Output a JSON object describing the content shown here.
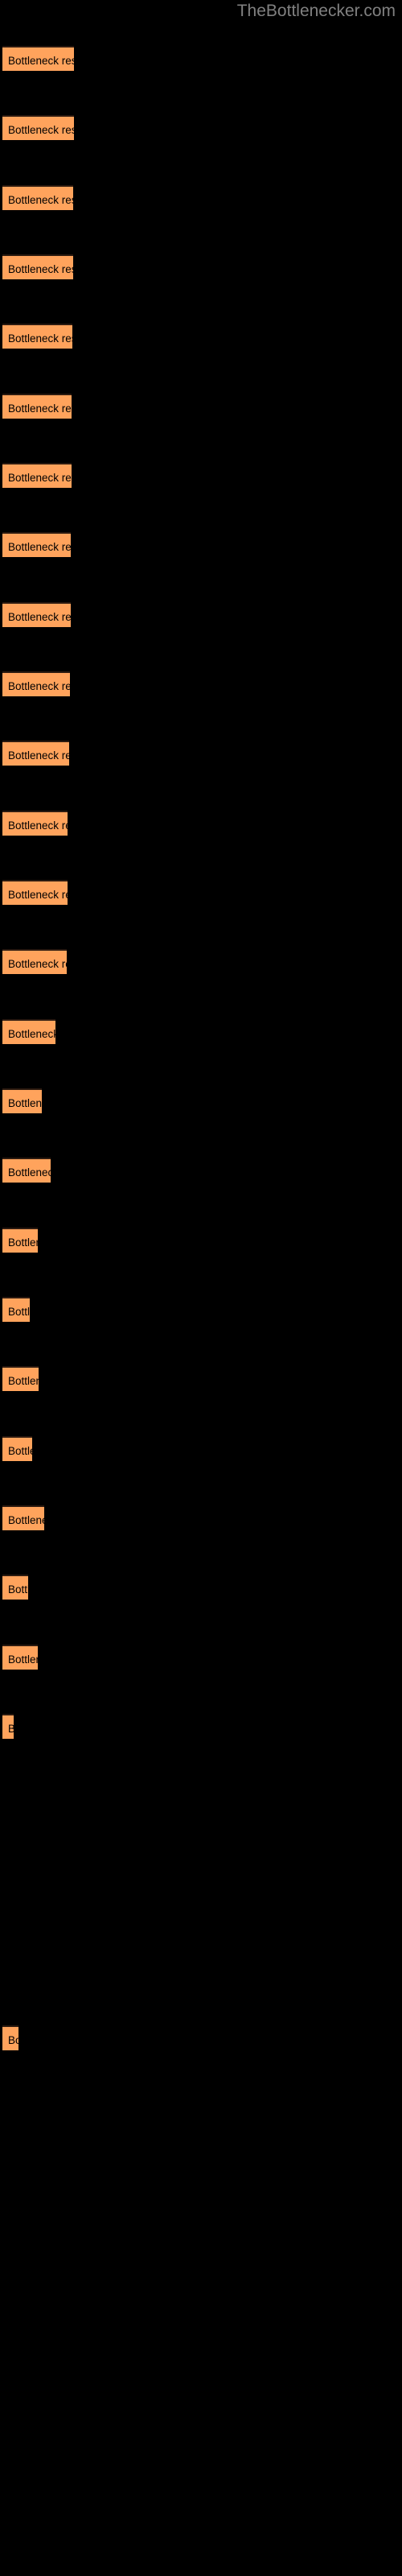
{
  "site": {
    "watermark": "TheBottlenecker.com"
  },
  "chart_data": {
    "type": "bar",
    "orientation": "horizontal",
    "title": "",
    "subtitle": "",
    "xlabel": "",
    "ylabel": "",
    "grid": false,
    "legend": null,
    "background_color": "#000000",
    "bar_color": "#ffa35c",
    "bar_border_color": "#2b1a10",
    "label_color": "#000000",
    "watermark_color": "#808080",
    "bar_label_text": "Bottleneck result",
    "xlim": [
      0,
      500
    ],
    "categories": [
      "Bottleneck result",
      "Bottleneck result",
      "Bottleneck result",
      "Bottleneck result",
      "Bottleneck result",
      "Bottleneck result",
      "Bottleneck result",
      "Bottleneck result",
      "Bottleneck result",
      "Bottleneck result",
      "Bottleneck result",
      "Bottleneck result",
      "Bottleneck result",
      "Bottleneck result",
      "Bottleneck result",
      "Bottleneck result",
      "Bottleneck result",
      "Bottleneck result",
      "Bottleneck result",
      "Bottleneck result",
      "Bottleneck result",
      "Bottleneck result",
      "Bottleneck result",
      "Bottleneck result",
      "Bottleneck result"
    ],
    "values": [
      89,
      89,
      88,
      88,
      87,
      86,
      86,
      85,
      85,
      84,
      80,
      78,
      78,
      77,
      65,
      50,
      60,
      45,
      35,
      46,
      38,
      52,
      33,
      44,
      14
    ],
    "bars": [
      {
        "index": 1,
        "top": 57,
        "width": 89,
        "label": "Bottleneck result"
      },
      {
        "index": 2,
        "top": 143,
        "width": 89,
        "label": "Bottleneck result"
      },
      {
        "index": 3,
        "top": 230,
        "width": 88,
        "label": "Bottleneck result"
      },
      {
        "index": 4,
        "top": 316,
        "width": 88,
        "label": "Bottleneck result"
      },
      {
        "index": 5,
        "top": 402,
        "width": 87,
        "label": "Bottleneck result"
      },
      {
        "index": 6,
        "top": 489,
        "width": 86,
        "label": "Bottleneck result"
      },
      {
        "index": 7,
        "top": 575,
        "width": 86,
        "label": "Bottleneck result"
      },
      {
        "index": 8,
        "top": 661,
        "width": 85,
        "label": "Bottleneck result"
      },
      {
        "index": 9,
        "top": 748,
        "width": 85,
        "label": "Bottleneck result"
      },
      {
        "index": 10,
        "top": 834,
        "width": 84,
        "label": "Bottleneck result"
      },
      {
        "index": 11,
        "top": 920,
        "width": 83,
        "label": "Bottleneck result"
      },
      {
        "index": 12,
        "top": 1007,
        "width": 81,
        "label": "Bottleneck result"
      },
      {
        "index": 13,
        "top": 1093,
        "width": 81,
        "label": "Bottleneck result"
      },
      {
        "index": 14,
        "top": 1179,
        "width": 80,
        "label": "Bottleneck result"
      },
      {
        "index": 15,
        "top": 1266,
        "width": 66,
        "label": "Bottleneck result"
      },
      {
        "index": 16,
        "top": 1352,
        "width": 49,
        "label": "Bottleneck result"
      },
      {
        "index": 17,
        "top": 1438,
        "width": 60,
        "label": "Bottleneck result"
      },
      {
        "index": 18,
        "top": 1525,
        "width": 44,
        "label": "Bottleneck result"
      },
      {
        "index": 19,
        "top": 1611,
        "width": 34,
        "label": "Bottleneck result"
      },
      {
        "index": 20,
        "top": 1697,
        "width": 45,
        "label": "Bottleneck result"
      },
      {
        "index": 21,
        "top": 1784,
        "width": 37,
        "label": "Bottleneck result"
      },
      {
        "index": 22,
        "top": 1870,
        "width": 52,
        "label": "Bottleneck result"
      },
      {
        "index": 23,
        "top": 1956,
        "width": 32,
        "label": "Bottleneck result"
      },
      {
        "index": 24,
        "top": 2043,
        "width": 44,
        "label": "Bottleneck result"
      },
      {
        "index": 25,
        "top": 2129,
        "width": 14,
        "label": "Bottleneck result"
      },
      {
        "index": 26,
        "top": 2516,
        "width": 20,
        "label": "Bottleneck result"
      }
    ]
  }
}
